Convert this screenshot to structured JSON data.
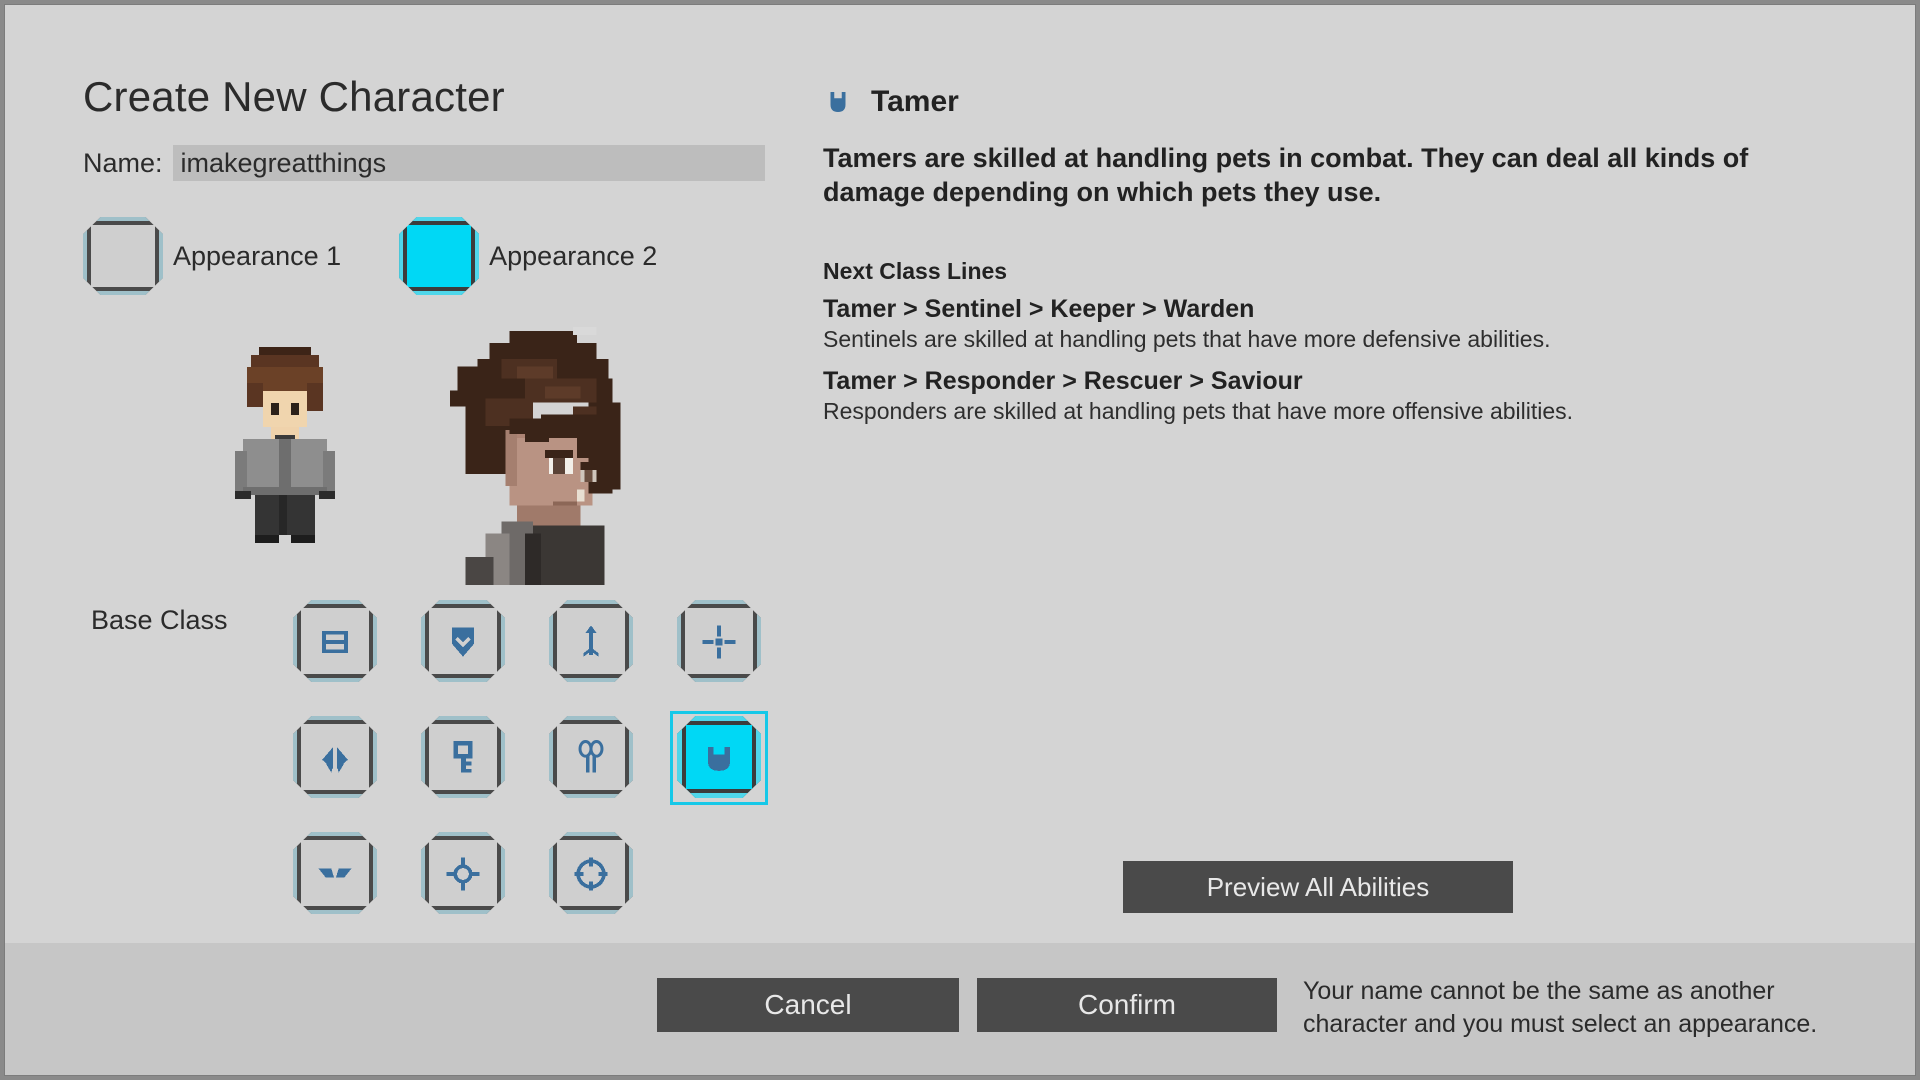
{
  "window": {
    "title": "Create New Character"
  },
  "name_field": {
    "label": "Name:",
    "value": "imakegreatthings",
    "placeholder": ""
  },
  "appearance": {
    "options": [
      {
        "label": "Appearance 1",
        "selected": false
      },
      {
        "label": "Appearance 2",
        "selected": true
      }
    ]
  },
  "base_class": {
    "label": "Base Class",
    "rows": [
      [
        {
          "icon": "book-icon",
          "selected": false
        },
        {
          "icon": "shield-icon",
          "selected": false
        },
        {
          "icon": "arrow-icon",
          "selected": false
        },
        {
          "icon": "crosshair-icon",
          "selected": false
        }
      ],
      [
        {
          "icon": "dual-blades-icon",
          "selected": false
        },
        {
          "icon": "key-icon",
          "selected": false
        },
        {
          "icon": "scissors-icon",
          "selected": false
        },
        {
          "icon": "collar-icon",
          "selected": true
        }
      ],
      [
        {
          "icon": "wings-icon",
          "selected": false
        },
        {
          "icon": "orb-icon",
          "selected": false
        },
        {
          "icon": "dial-icon",
          "selected": false
        }
      ]
    ]
  },
  "class_info": {
    "icon": "collar-icon",
    "name": "Tamer",
    "description": "Tamers are skilled at handling pets in combat. They can deal all kinds of damage depending on which pets they use.",
    "next_lines_title": "Next Class Lines",
    "lines": [
      {
        "path": "Tamer > Sentinel > Keeper > Warden",
        "description": "Sentinels are skilled at handling pets that have more defensive abilities."
      },
      {
        "path": "Tamer > Responder > Rescuer > Saviour",
        "description": "Responders are skilled at handling pets that have more offensive abilities."
      }
    ],
    "preview_button": "Preview All Abilities"
  },
  "footer": {
    "cancel_label": "Cancel",
    "confirm_label": "Confirm",
    "warning": "Your name cannot be the same as another character and you must select an appearance."
  },
  "colors": {
    "panel_bg": "#d4d4d4",
    "footer_bg": "#c6c6c6",
    "accent_cyan": "#00d8f5",
    "icon_blue": "#3a6f9e",
    "button_dark": "#4a4a4a",
    "text": "#2b2b2b"
  }
}
